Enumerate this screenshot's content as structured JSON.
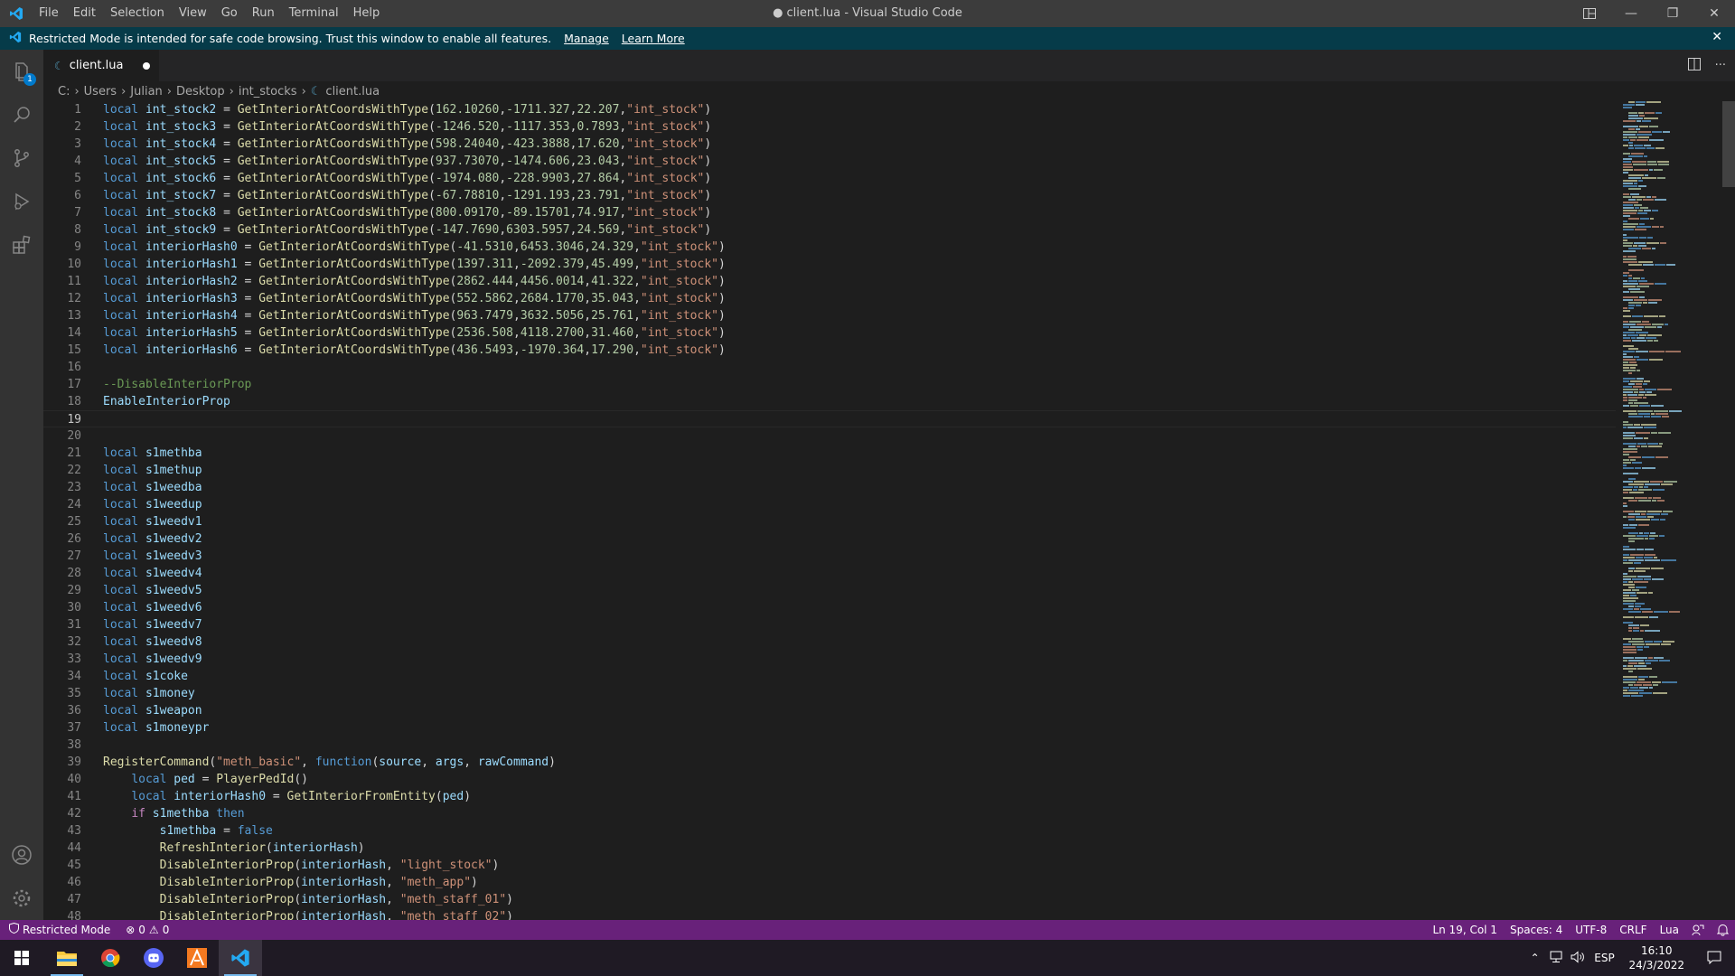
{
  "titlebar": {
    "menu": [
      "File",
      "Edit",
      "Selection",
      "View",
      "Go",
      "Run",
      "Terminal",
      "Help"
    ],
    "title": "● client.lua - Visual Studio Code"
  },
  "banner": {
    "text": "Restricted Mode is intended for safe code browsing. Trust this window to enable all features.",
    "manage": "Manage",
    "learn_more": "Learn More"
  },
  "activitybar": {
    "explorer_badge": "1"
  },
  "tab": {
    "label": "client.lua"
  },
  "breadcrumb": [
    "C:",
    "Users",
    "Julian",
    "Desktop",
    "int_stocks",
    "client.lua"
  ],
  "editor": {
    "lines": [
      "local int_stock2 = GetInteriorAtCoordsWithType(162.10260,-1711.327,22.207,\"int_stock\")",
      "local int_stock3 = GetInteriorAtCoordsWithType(-1246.520,-1117.353,0.7893,\"int_stock\")",
      "local int_stock4 = GetInteriorAtCoordsWithType(598.24040,-423.3888,17.620,\"int_stock\")",
      "local int_stock5 = GetInteriorAtCoordsWithType(937.73070,-1474.606,23.043,\"int_stock\")",
      "local int_stock6 = GetInteriorAtCoordsWithType(-1974.080,-228.9903,27.864,\"int_stock\")",
      "local int_stock7 = GetInteriorAtCoordsWithType(-67.78810,-1291.193,23.791,\"int_stock\")",
      "local int_stock8 = GetInteriorAtCoordsWithType(800.09170,-89.15701,74.917,\"int_stock\")",
      "local int_stock9 = GetInteriorAtCoordsWithType(-147.7690,6303.5957,24.569,\"int_stock\")",
      "local interiorHash0 = GetInteriorAtCoordsWithType(-41.5310,6453.3046,24.329,\"int_stock\")",
      "local interiorHash1 = GetInteriorAtCoordsWithType(1397.311,-2092.379,45.499,\"int_stock\")",
      "local interiorHash2 = GetInteriorAtCoordsWithType(2862.444,4456.0014,41.322,\"int_stock\")",
      "local interiorHash3 = GetInteriorAtCoordsWithType(552.5862,2684.1770,35.043,\"int_stock\")",
      "local interiorHash4 = GetInteriorAtCoordsWithType(963.7479,3632.5056,25.761,\"int_stock\")",
      "local interiorHash5 = GetInteriorAtCoordsWithType(2536.508,4118.2700,31.460,\"int_stock\")",
      "local interiorHash6 = GetInteriorAtCoordsWithType(436.5493,-1970.364,17.290,\"int_stock\")",
      "",
      "--DisableInteriorProp",
      "EnableInteriorProp",
      "",
      "",
      "local s1methba",
      "local s1methup",
      "local s1weedba",
      "local s1weedup",
      "local s1weedv1",
      "local s1weedv2",
      "local s1weedv3",
      "local s1weedv4",
      "local s1weedv5",
      "local s1weedv6",
      "local s1weedv7",
      "local s1weedv8",
      "local s1weedv9",
      "local s1coke",
      "local s1money",
      "local s1weapon",
      "local s1moneypr",
      "",
      "RegisterCommand(\"meth_basic\", function(source, args, rawCommand)",
      "    local ped = PlayerPedId()",
      "    local interiorHash0 = GetInteriorFromEntity(ped)",
      "    if s1methba then",
      "        s1methba = false",
      "        RefreshInterior(interiorHash)",
      "        DisableInteriorProp(interiorHash, \"light_stock\")",
      "        DisableInteriorProp(interiorHash, \"meth_app\")",
      "        DisableInteriorProp(interiorHash, \"meth_staff_01\")",
      "        DisableInteriorProp(interiorHash, \"meth_staff_02\")"
    ],
    "current_line": 19
  },
  "statusbar": {
    "restricted": "Restricted Mode",
    "errors": "0",
    "warnings": "0",
    "position": "Ln 19, Col 1",
    "spaces": "Spaces: 4",
    "encoding": "UTF-8",
    "eol": "CRLF",
    "language": "Lua"
  },
  "taskbar": {
    "lang": "ESP",
    "time": "16:10",
    "date": "24/3/2022"
  }
}
